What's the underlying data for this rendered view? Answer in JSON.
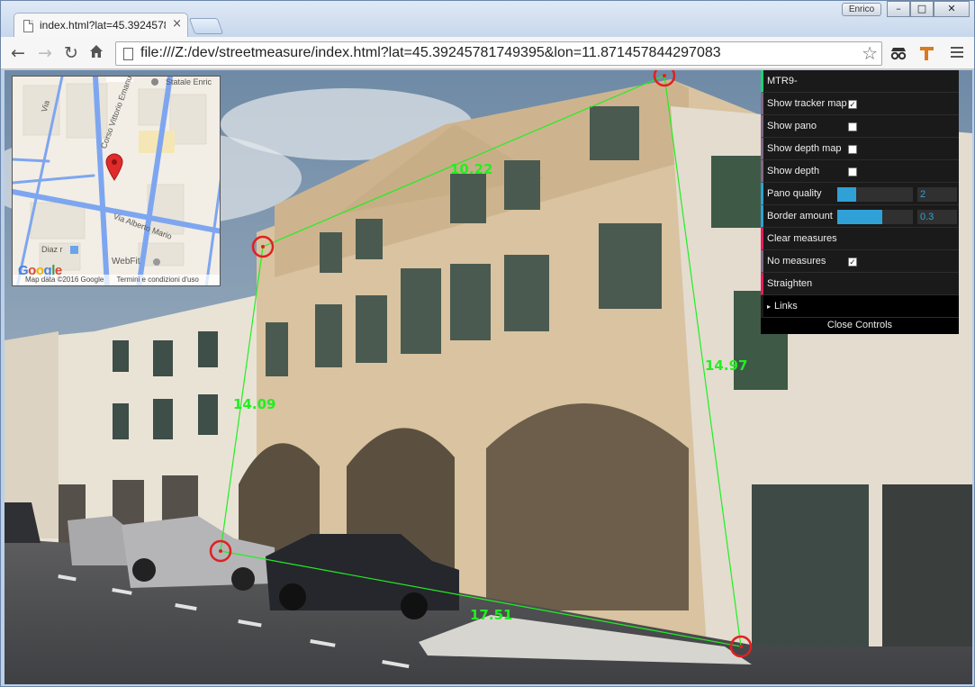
{
  "window": {
    "user_name": "Enrico",
    "controls": {
      "minimize": "–",
      "maximize": "□",
      "close": "✕"
    }
  },
  "tab": {
    "title": "index.html?lat=45.3924578",
    "close_glyph": "×"
  },
  "toolbar": {
    "back_icon": "back-arrow-icon",
    "forward_icon": "forward-arrow-icon",
    "reload_icon": "reload-icon",
    "home_icon": "home-icon",
    "url": "file:///Z:/dev/streetmeasure/index.html?lat=45.39245781749395&lon=11.871457844297083",
    "star_glyph": "☆"
  },
  "map": {
    "labels": {
      "street_top": "Statale Enric",
      "via_left": "Via",
      "corso": "Corso Vittorio Emanuele II",
      "via_alberto": "Via Alberto Mario",
      "diaz": "Diaz r",
      "webfit": "WebFit",
      "google": "Google"
    },
    "attribution": {
      "data": "Map data ©2016 Google",
      "terms": "Termini e condizioni d'uso"
    },
    "colors": {
      "road": "#7ea6f0",
      "block": "#f2eee5",
      "marker": "#e02b2b"
    }
  },
  "measures": {
    "labels": [
      "10.22",
      "14.97",
      "17.51",
      "14.09"
    ],
    "color": "#22ee22",
    "point_color": "#e02020"
  },
  "controls": {
    "title": "MTR9-",
    "show_tracker_map": {
      "label": "Show tracker map",
      "checked": true
    },
    "show_pano": {
      "label": "Show pano",
      "checked": false
    },
    "show_depth_map": {
      "label": "Show depth map",
      "checked": false
    },
    "show_depth": {
      "label": "Show depth",
      "checked": false
    },
    "pano_quality": {
      "label": "Pano quality",
      "value": "2",
      "fill_fraction": 0.25
    },
    "border_amount": {
      "label": "Border amount",
      "value": "0.3",
      "fill_fraction": 0.6
    },
    "clear_measures": {
      "label": "Clear measures"
    },
    "no_measures": {
      "label": "No measures",
      "checked": true
    },
    "straighten": {
      "label": "Straighten"
    },
    "links": {
      "label": "Links",
      "glyph": "▸"
    },
    "close_label": "Close Controls",
    "colors": {
      "accent_number": "#2fa1d6",
      "accent_button": "#e61d5f",
      "accent_bool": "#806787"
    }
  }
}
